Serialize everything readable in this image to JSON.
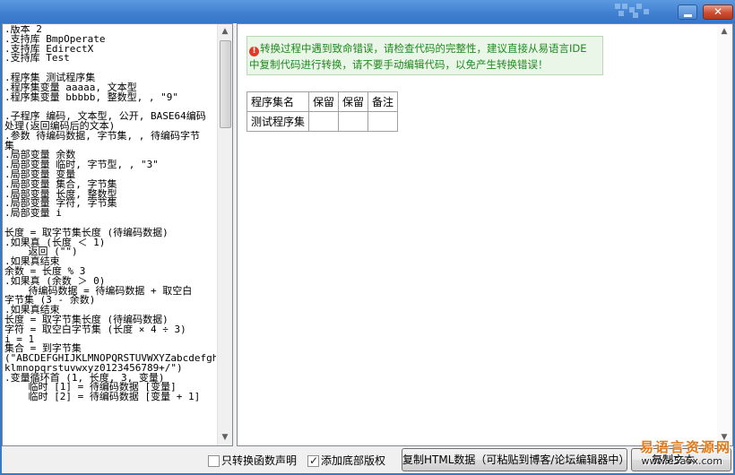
{
  "window": {
    "min_symbol": "",
    "close_symbol": "✕"
  },
  "code_editor": {
    "lines": [
      ".版本 2",
      ".支持库 BmpOperate",
      ".支持库 EdirectX",
      ".支持库 Test",
      "",
      ".程序集 测试程序集",
      ".程序集变量 aaaaa, 文本型",
      ".程序集变量 bbbbb, 整数型, , \"9\"",
      "",
      ".子程序 编码, 文本型, 公开, BASE64编码",
      "处理(返回编码后的文本)",
      ".参数 待编码数据, 字节集, , 待编码字节",
      "集",
      ".局部变量 余数",
      ".局部变量 临时, 字节型, , \"3\"",
      ".局部变量 变量",
      ".局部变量 集合, 字节集",
      ".局部变量 长度, 整数型",
      ".局部变量 字符, 字节集",
      ".局部变量 i",
      "",
      "长度 = 取字节集长度 (待编码数据)",
      ".如果真 (长度 ＜ 1)",
      "    返回 (\"\")",
      ".如果真结束",
      "余数 = 长度 % 3",
      ".如果真 (余数 ＞ 0)",
      "    待编码数据 = 待编码数据 + 取空白",
      "字节集 (3 - 余数)",
      ".如果真结束",
      "长度 = 取字节集长度 (待编码数据)",
      "字符 = 取空白字节集 (长度 × 4 ÷ 3)",
      "i = 1",
      "集合 = 到字节集",
      "(\"ABCDEFGHIJKLMNOPQRSTUVWXYZabcdefghij",
      "klmnopqrstuvwxyz0123456789+/\")",
      ".变量循环首 (1, 长度, 3, 变量)",
      "    临时 [1] = 待编码数据 [变量]",
      "    临时 [2] = 待编码数据 [变量 + 1]"
    ],
    "scroll_up": "▲",
    "scroll_down": "▼"
  },
  "preview": {
    "warning_icon": "!",
    "warning_line1": "转换过程中遇到致命错误，请检查代码的完整性，建议直接从易语言IDE",
    "warning_line2": "中复制代码进行转换，请不要手动编辑代码，以免产生转换错误！",
    "table": {
      "headers": [
        "程序集名",
        "保留",
        "保留",
        "备注"
      ],
      "rows": [
        [
          "测试程序集",
          "",
          "",
          ""
        ]
      ]
    },
    "scroll_up": "▲",
    "scroll_down": "▼"
  },
  "bottom_bar": {
    "only_convert_label": "只转换函数声明",
    "only_convert_checked": false,
    "add_copyright_label": "添加底部版权",
    "add_copyright_checked": true,
    "copy_html_label": "复制HTML数据（可粘贴到博客/论坛编辑器中）",
    "copy_text_label": "复制文本"
  },
  "watermark": {
    "title": "易语言资源网",
    "url": "www.e5a5x.com"
  },
  "colors": {
    "titlebar": "#3f7fd0",
    "warning_text": "#1e8a1e",
    "warning_bg": "#eaf6e8",
    "watermark_title": "#e07a1a"
  }
}
